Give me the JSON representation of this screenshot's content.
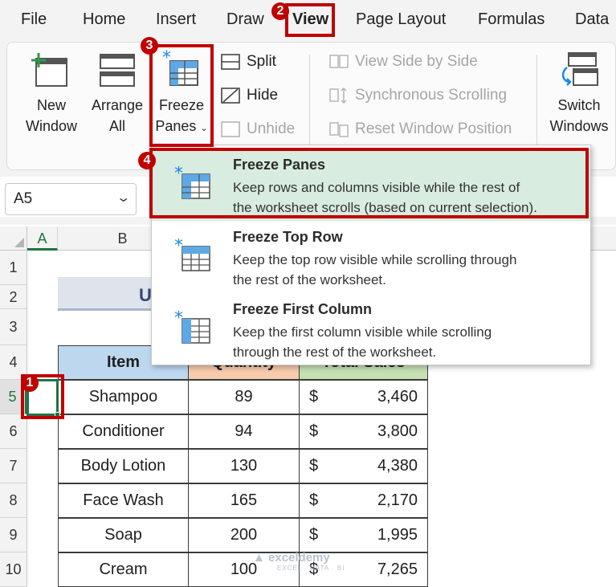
{
  "menu": {
    "items": [
      "File",
      "Home",
      "Insert",
      "Draw",
      "View",
      "Page Layout",
      "Formulas",
      "Data"
    ]
  },
  "ribbon": {
    "new_window": [
      "New",
      "Window"
    ],
    "arrange_all": [
      "Arrange",
      "All"
    ],
    "freeze_panes": [
      "Freeze",
      "Panes"
    ],
    "split": "Split",
    "hide": "Hide",
    "unhide": "Unhide",
    "view_side_by_side": "View Side by Side",
    "synchronous_scrolling": "Synchronous Scrolling",
    "reset_window_position": "Reset Window Position",
    "switch_windows": [
      "Switch",
      "Windows"
    ]
  },
  "name_box": {
    "value": "A5"
  },
  "dropdown": {
    "items": [
      {
        "title": "Freeze Panes",
        "lines": [
          "Keep rows and columns visible while the rest of",
          "the worksheet scrolls (based on current selection)."
        ]
      },
      {
        "title": "Freeze Top Row",
        "lines": [
          "Keep the top row visible while scrolling through",
          "the rest of the worksheet."
        ]
      },
      {
        "title": "Freeze First Column",
        "lines": [
          "Keep the first column visible while scrolling",
          "through the rest of the worksheet."
        ]
      }
    ]
  },
  "grid": {
    "columns": [
      "A",
      "B"
    ],
    "rows": [
      "1",
      "2",
      "3",
      "4",
      "5",
      "6",
      "7",
      "8",
      "9",
      "10"
    ],
    "title_fragment": "U"
  },
  "table": {
    "headers": [
      "Item",
      "Quantity",
      "Total Sales"
    ],
    "rows": [
      {
        "item": "Shampoo",
        "qty": "89",
        "currency": "$",
        "sales": "3,460"
      },
      {
        "item": "Conditioner",
        "qty": "94",
        "currency": "$",
        "sales": "3,800"
      },
      {
        "item": "Body Lotion",
        "qty": "130",
        "currency": "$",
        "sales": "4,380"
      },
      {
        "item": "Face Wash",
        "qty": "165",
        "currency": "$",
        "sales": "2,170"
      },
      {
        "item": "Soap",
        "qty": "200",
        "currency": "$",
        "sales": "1,995"
      },
      {
        "item": "Cream",
        "qty": "100",
        "currency": "$",
        "sales": "7,265"
      }
    ]
  },
  "annotations": {
    "badges": [
      "1",
      "2",
      "3",
      "4"
    ]
  },
  "watermark": {
    "name": "exceldemy",
    "tagline": "EXCEL · DATA · BI"
  },
  "colors": {
    "accent_red": "#c00000",
    "header_item": "#bdd7ee",
    "header_quantity": "#f8cbad",
    "header_sales": "#c6e0b4",
    "selection_green": "#217346",
    "dropdown_highlight": "#d8ecdf",
    "icon_blue": "#1e88e5"
  }
}
